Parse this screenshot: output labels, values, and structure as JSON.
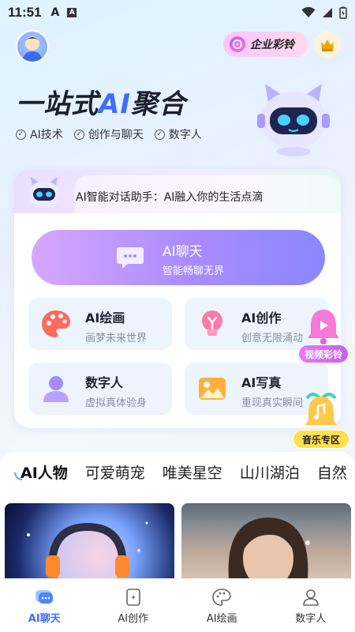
{
  "status_bar": {
    "time": "11:51",
    "app_icon_1": "A",
    "app_icon_2": "A"
  },
  "header": {
    "vip_label": "企业彩铃"
  },
  "hero": {
    "title_prefix": "一站式",
    "title_ai": "AI",
    "title_suffix": "聚合",
    "features": [
      "AI技术",
      "创作与聊天",
      "数字人"
    ]
  },
  "assistant": {
    "text": "AI智能对话助手：AI融入你的生活点滴"
  },
  "chat_button": {
    "title": "AI聊天",
    "subtitle": "智能畅聊无界"
  },
  "tiles": [
    {
      "title": "AI绘画",
      "subtitle": "画梦未来世界"
    },
    {
      "title": "AI创作",
      "subtitle": "创意无限涌动"
    },
    {
      "title": "数字人",
      "subtitle": "虚拟真体验身"
    },
    {
      "title": "AI写真",
      "subtitle": "重现真实瞬间"
    }
  ],
  "floating": {
    "video_ringtone": "视频彩铃",
    "music_zone": "音乐专区"
  },
  "categories": [
    "AI人物",
    "可爱萌宠",
    "唯美星空",
    "山川湖泊",
    "自然"
  ],
  "tabbar": [
    {
      "label": "AI聊天",
      "icon": "chat-bubble-icon"
    },
    {
      "label": "AI创作",
      "icon": "create-card-icon"
    },
    {
      "label": "AI绘画",
      "icon": "palette-icon"
    },
    {
      "label": "数字人",
      "icon": "person-icon"
    }
  ],
  "colors": {
    "accent": "#3f6dff",
    "chat_gradient_start": "#d6a7ff",
    "chat_gradient_end": "#8a87ff",
    "music_badge": "#ffe14d",
    "video_badge": "#e879f9"
  }
}
